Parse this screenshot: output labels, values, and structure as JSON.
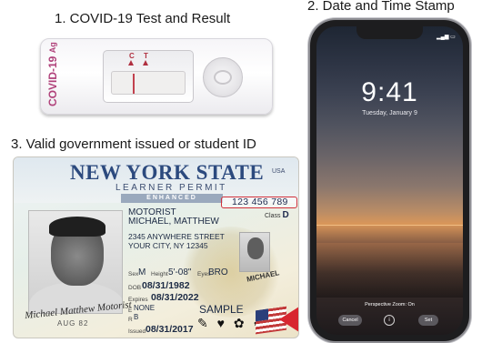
{
  "captions": {
    "test": "1. COVID-19 Test and Result",
    "timestamp": "2.  Date and Time Stamp",
    "id": "3. Valid government issued or student ID"
  },
  "test_cassette": {
    "brand_line1": "COVID-19",
    "brand_line2": "Ag",
    "marker_c": "C",
    "marker_t": "T"
  },
  "id_card": {
    "state": "NEW YORK STATE",
    "usa": "USA",
    "permit": "LEARNER PERMIT",
    "enhanced": "ENHANCED",
    "id_number": "123 456 789",
    "class_label": "Class",
    "class_value": "D",
    "name_line1": "MOTORIST",
    "name_line2": "MICHAEL, MATTHEW",
    "address_line1": "2345 ANYWHERE STREET",
    "address_line2": "YOUR CITY, NY 12345",
    "sex_label": "Sex",
    "sex_value": "M",
    "height_label": "Height",
    "height_value": "5'-08\"",
    "eyes_label": "Eyes",
    "eyes_value": "BRO",
    "dob_label": "DOB",
    "dob_value": "08/31/1982",
    "expires_label": "Expires",
    "expires_value": "08/31/2022",
    "e_label": "E",
    "e_value": "NONE",
    "r_label": "R",
    "r_value": "B",
    "issued_label": "Issued",
    "issued_value": "08/31/2017",
    "sample": "SAMPLE",
    "signature": "Michael Matthew Motorist",
    "ghost_name": "MICHAEL",
    "aug": "AUG 82",
    "icons": "✎ ♥ ✿ ☘"
  },
  "phone": {
    "time": "9:41",
    "date": "Tuesday, January 9",
    "perspective": "Perspective Zoom: On",
    "cancel": "Cancel",
    "info": "i",
    "set": "Set"
  }
}
